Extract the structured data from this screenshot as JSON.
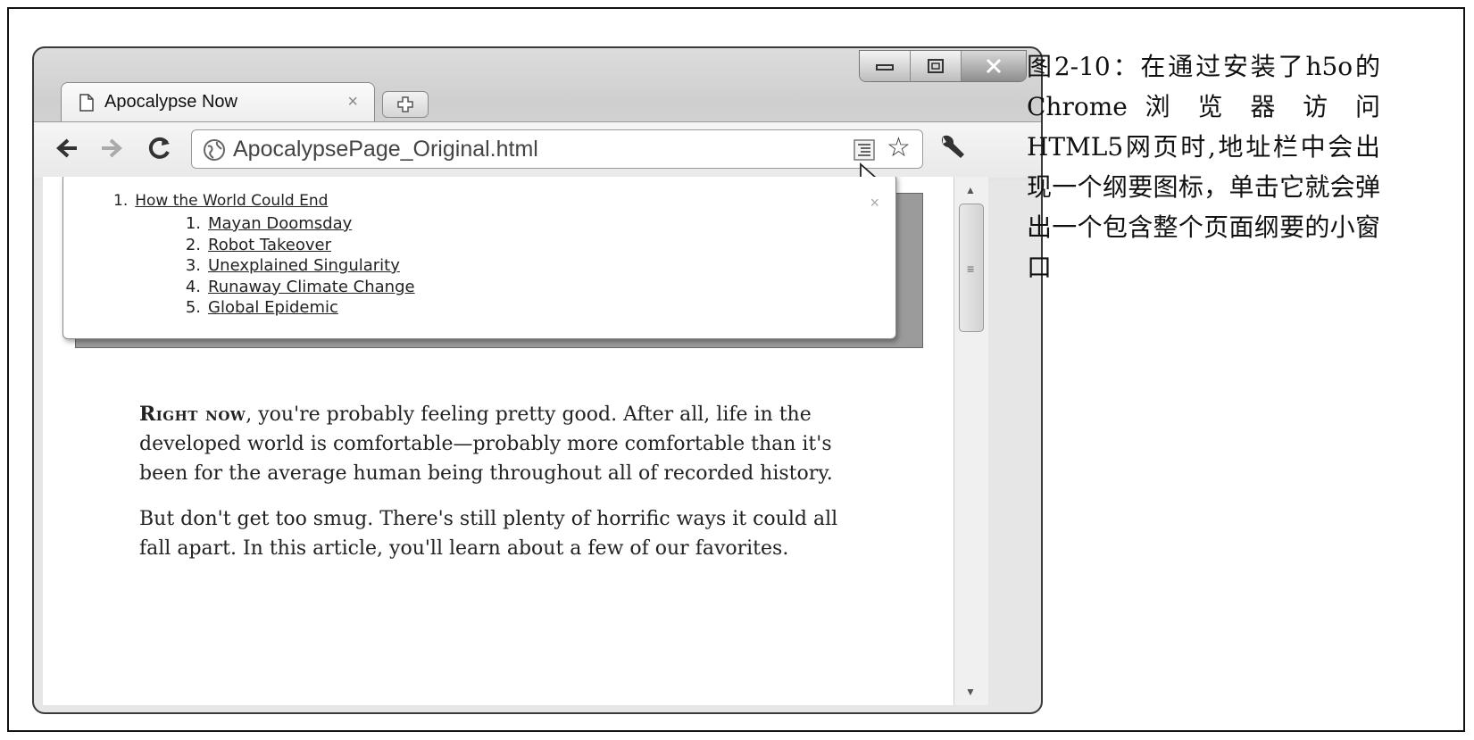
{
  "browser": {
    "tab_title": "Apocalypse Now",
    "tab_close": "×",
    "url": "ApocalypsePage_Original.html"
  },
  "outline_popup": {
    "close": "×",
    "top_item": {
      "number": "1.",
      "label": "How the World Could End"
    },
    "sub_items": [
      {
        "number": "1.",
        "label": "Mayan Doomsday"
      },
      {
        "number": "2.",
        "label": "Robot Takeover"
      },
      {
        "number": "3.",
        "label": "Unexplained Singularity"
      },
      {
        "number": "4.",
        "label": "Runaway Climate Change"
      },
      {
        "number": "5.",
        "label": "Global Epidemic"
      }
    ]
  },
  "article": {
    "lead": "Right now",
    "p1_rest": ", you're probably feeling pretty good. After all, life in the developed world is comfortable—probably more comfortable than it's been for the average human being throughout all of recorded history.",
    "p2": "But don't get too smug. There's still plenty of horrific ways it could all fall apart. In this article, you'll learn about a few of our favorites."
  },
  "caption": "图2-10：在通过安装了h5o的 Chrome 浏 览 器 访 问 HTML5网页时,地址栏中会出现一个纲要图标，单击它就会弹出一个包含整个页面纲要的小窗口"
}
